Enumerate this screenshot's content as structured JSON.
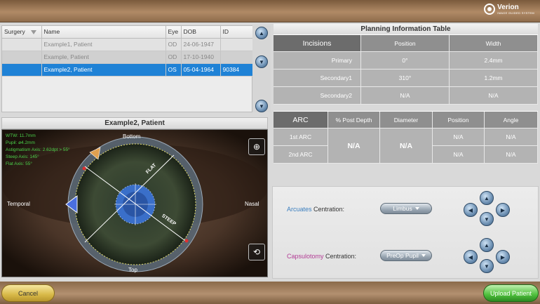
{
  "brand": {
    "name": "Verion",
    "subtitle": "IMAGE GUIDED SYSTEM"
  },
  "patient_list": {
    "columns": [
      "Surgery",
      "Name",
      "Eye",
      "DOB",
      "ID"
    ],
    "rows": [
      {
        "surgery": "",
        "name": "Example1, Patient",
        "eye": "OD",
        "dob": "24-06-1947",
        "id": ""
      },
      {
        "surgery": "",
        "name": "Example, Patient",
        "eye": "OD",
        "dob": "17-10-1940",
        "id": ""
      },
      {
        "surgery": "",
        "name": "Example2, Patient",
        "eye": "OS",
        "dob": "05-04-1964",
        "id": "90384"
      }
    ],
    "selected_index": 2
  },
  "eye_panel": {
    "title": "Example2, Patient",
    "info_lines": [
      "WTW: 11.7mm",
      "Pupil: ø4.2mm",
      "Astigmatism Axis: 2.62dpt > 55°",
      "Steep Axis: 145°",
      "Flat Axis: 55°"
    ],
    "labels": {
      "bottom": "Bottom",
      "top": "Top",
      "temporal": "Temporal",
      "nasal": "Nasal",
      "flat": "FLAT",
      "steep": "STEEP"
    },
    "icons": {
      "zoom": "zoom-in-icon",
      "rotate": "rotate-icon"
    }
  },
  "planning_table": {
    "title": "Planning Information Table",
    "incisions_header": [
      "Incisions",
      "Position",
      "Width"
    ],
    "incisions": [
      {
        "name": "Primary",
        "position": "0°",
        "width": "2.4mm"
      },
      {
        "name": "Secondary1",
        "position": "310°",
        "width": "1.2mm"
      },
      {
        "name": "Secondary2",
        "position": "N/A",
        "width": "N/A"
      }
    ],
    "arc_header": [
      "ARC",
      "% Post Depth",
      "Diameter",
      "Position",
      "Angle"
    ],
    "arcs": [
      {
        "name": "1st ARC",
        "position": "N/A",
        "angle": "N/A"
      },
      {
        "name": "2nd ARC",
        "position": "N/A",
        "angle": "N/A"
      }
    ],
    "post_depth": "N/A",
    "diameter": "N/A"
  },
  "centration": {
    "arcuates": {
      "accent": "Arcuates",
      "label": " Centration:",
      "value": "Limbus"
    },
    "capsulotomy": {
      "accent": "Capsulotomy",
      "label": " Centration:",
      "value": "PreOp Pupil"
    }
  },
  "footer": {
    "cancel": "Cancel",
    "upload": "Upload Patient"
  },
  "colors": {
    "selected_row": "#1f82d6",
    "overlay_text": "#4cd14a",
    "cancel": "#d8b948",
    "upload": "#4fc03c"
  }
}
